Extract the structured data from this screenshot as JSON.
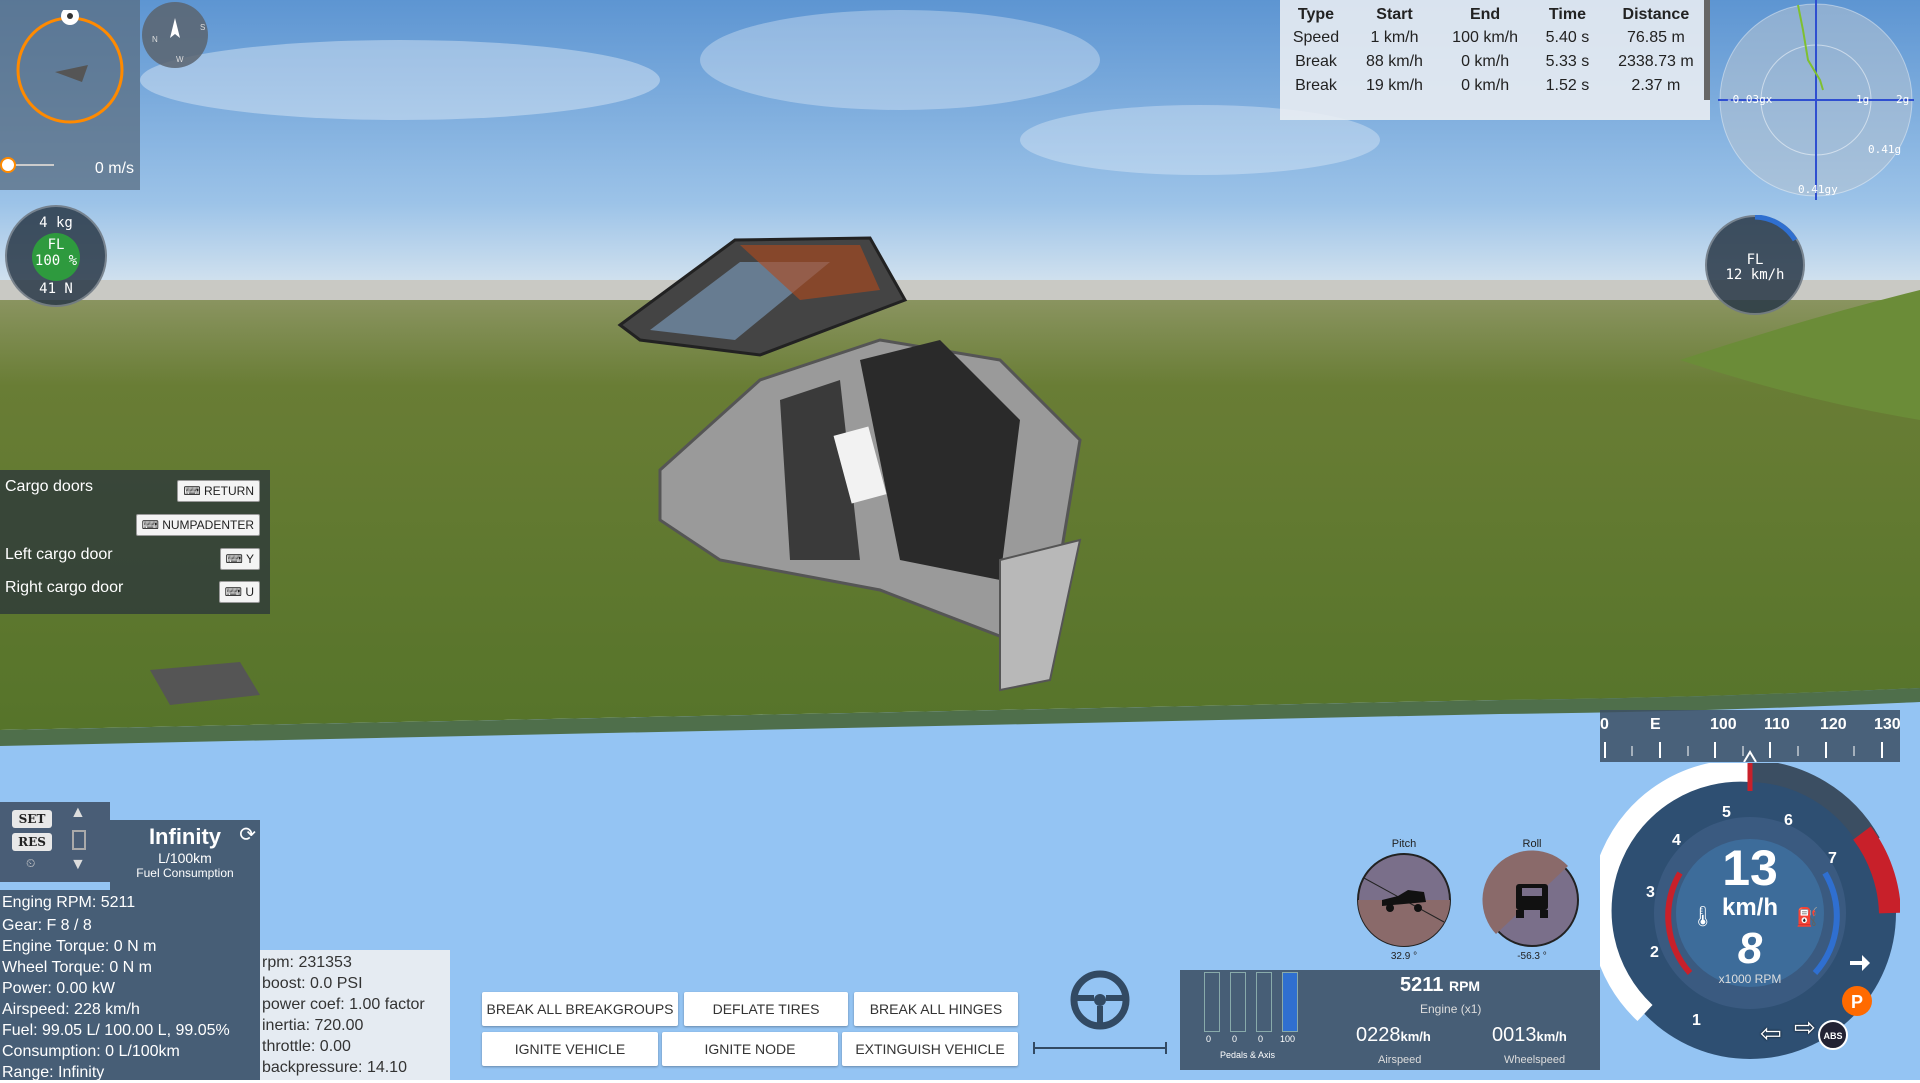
{
  "colors": {
    "sky_top": "#6fa3d8",
    "sky_bottom": "#cfe0ef",
    "grass": "#5e7a2f",
    "water": "#94c4f3",
    "panel_dark": "#3a4a5c",
    "accent_orange": "#ff8a00",
    "redline": "#c8202a",
    "rpm_blue": "#2f6fd0",
    "tire_green": "#2e9a3e"
  },
  "nav": {
    "speed": "0 m/s",
    "compass_icon": "compass-icon"
  },
  "tire_left": {
    "weight": "4  kg",
    "label": "FL",
    "percent": "100 %",
    "force": "41  N"
  },
  "tire_right": {
    "label": "FL",
    "speed": "12  km/h"
  },
  "gforce": {
    "x": "-0.03gx",
    "g1": "1g",
    "g2": "2g",
    "right": "0.41g",
    "bottom": "0.41gy"
  },
  "drag_table": {
    "headers": [
      "Type",
      "Start",
      "End",
      "Time",
      "Distance"
    ],
    "rows": [
      [
        "Speed",
        "1 km/h",
        "100 km/h",
        "5.40 s",
        "76.85 m"
      ],
      [
        "Break",
        "88 km/h",
        "0 km/h",
        "5.33 s",
        "2338.73 m"
      ],
      [
        "Break",
        "19 km/h",
        "0 km/h",
        "1.52 s",
        "2.37 m"
      ]
    ]
  },
  "cargo_menu": {
    "title": "Cargo doors",
    "key_return": "RETURN",
    "key_numpad": "NUMPADENTER",
    "left_door": "Left cargo door",
    "key_left": "Y",
    "right_door": "Right cargo door",
    "key_right": "U"
  },
  "cruise": {
    "set": "SET",
    "res": "RES"
  },
  "fuel": {
    "value": "Infinity",
    "unit": "L/100km",
    "label": "Fuel Consumption"
  },
  "vehicle_info": [
    "Enging RPM: 5211",
    "Gear: F 8 / 8",
    "Engine Torque: 0 N m",
    "Wheel Torque: 0 N m",
    "Power: 0.00 kW",
    "Airspeed: 228 km/h",
    "Fuel: 99.05 L/ 100.00 L, 99.05%",
    "Consumption: 0 L/100km",
    "Range: Infinity"
  ],
  "engine_info": [
    "rpm: 231353",
    "boost: 0.0 PSI",
    "power coef: 1.00 factor",
    "inertia: 720.00",
    "throttle: 0.00",
    "backpressure: 14.10"
  ],
  "actions": {
    "break_breakgroups": "BREAK ALL BREAKGROUPS",
    "deflate_tires": "DEFLATE TIRES",
    "break_hinges": "BREAK ALL HINGES",
    "ignite_vehicle": "IGNITE VEHICLE",
    "ignite_node": "IGNITE NODE",
    "extinguish_vehicle": "EXTINGUISH VEHICLE"
  },
  "pitch": {
    "label": "Pitch",
    "value": "32.9 °"
  },
  "roll": {
    "label": "Roll",
    "value": "-56.3 °"
  },
  "pedals": {
    "label": "Pedals & Axis",
    "vals": [
      "0",
      "0",
      "0",
      "100"
    ],
    "levels": [
      0,
      0,
      0,
      1
    ]
  },
  "speed_panel": {
    "rpm": "5211",
    "rpm_unit": "RPM",
    "engine_label": "Engine (x1)",
    "airspeed": "0228",
    "airspeed_unit": "km/h",
    "airspeed_label": "Airspeed",
    "wheelspeed": "0013",
    "wheelspeed_unit": "km/h",
    "wheelspeed_label": "Wheelspeed"
  },
  "speed_tape": {
    "ticks": [
      "0",
      "E",
      "100",
      "110",
      "120",
      "130"
    ]
  },
  "tacho": {
    "speed": "13",
    "unit": "km/h",
    "gear": "8",
    "rpm_label": "x1000 RPM",
    "numbers": [
      "1",
      "2",
      "3",
      "4",
      "5",
      "6",
      "7"
    ],
    "parking": "P",
    "abs": "ABS"
  }
}
